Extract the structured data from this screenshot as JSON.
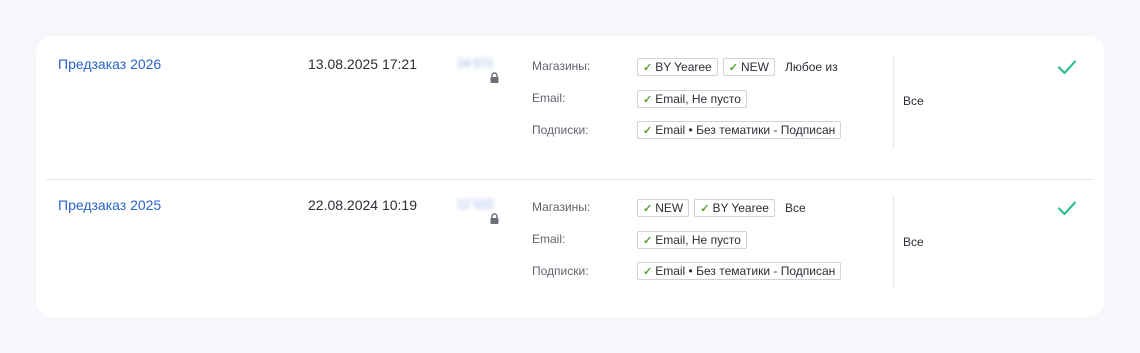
{
  "rows": [
    {
      "name": "Предзаказ 2026",
      "date": "13.08.2025 17:21",
      "count_blurred": "14 071",
      "conditions": {
        "shops_label": "Магазины:",
        "shops_tags": [
          "BY Yearee",
          "NEW"
        ],
        "shops_mode": "Любое из",
        "email_label": "Email:",
        "email_tags": [
          "Email, Не пусто"
        ],
        "subs_label": "Подписки:",
        "subs_tags": [
          "Email • Без тематики - Подписан"
        ]
      },
      "scope": "Все",
      "status_icon": "check-icon"
    },
    {
      "name": "Предзаказ 2025",
      "date": "22.08.2024 10:19",
      "count_blurred": "12 522",
      "conditions": {
        "shops_label": "Магазины:",
        "shops_tags": [
          "NEW",
          "BY Yearee"
        ],
        "shops_mode": "Все",
        "email_label": "Email:",
        "email_tags": [
          "Email, Не пусто"
        ],
        "subs_label": "Подписки:",
        "subs_tags": [
          "Email • Без тематики - Подписан"
        ]
      },
      "scope": "Все",
      "status_icon": "check-icon"
    }
  ],
  "colors": {
    "link": "#2a62c9",
    "check_tag": "#5aa02c",
    "status_check": "#2fc08a"
  }
}
